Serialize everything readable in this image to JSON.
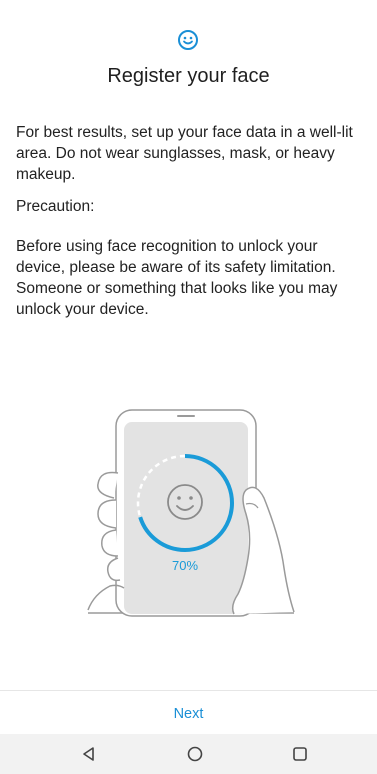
{
  "header": {
    "icon": "smiley-face-icon",
    "title": "Register your face"
  },
  "content": {
    "paragraph1": "For best results, set up your face data in a well-lit area. Do not wear sunglasses, mask, or heavy makeup.",
    "precaution_label": "Precaution:",
    "paragraph2": "Before using face recognition to unlock your device, please be aware of its safety limitation. Someone or something that looks like you may unlock your device."
  },
  "illustration": {
    "progress_percent": 70,
    "progress_label": "70%",
    "accent_color": "#1a9bd8"
  },
  "footer": {
    "next_label": "Next"
  },
  "navigation": {
    "back_icon": "back-triangle-icon",
    "home_icon": "home-circle-icon",
    "recents_icon": "recents-square-icon"
  }
}
